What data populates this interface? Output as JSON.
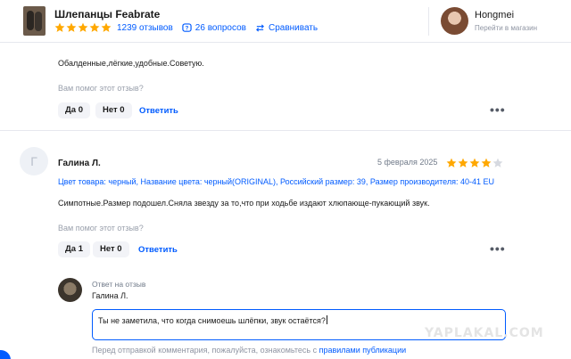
{
  "header": {
    "product_title": "Шлепанцы Feabrate",
    "rating_stars": 5,
    "reviews_count": "1239 отзывов",
    "questions_count": "26 вопросов",
    "compare_label": "Сравнивать",
    "seller": {
      "name": "Hongmei",
      "subtitle": "Перейти в магазин"
    }
  },
  "review_prev": {
    "text": "Обалденные,лёгкие,удобные.Советую.",
    "helpful_question": "Вам помог этот отзыв?",
    "yes_label": "Да 0",
    "no_label": "Нет 0",
    "reply_label": "Ответить",
    "more_label": "•••"
  },
  "review": {
    "avatar_letter": "Г",
    "author": "Галина Л.",
    "date": "5 февраля 2025",
    "rating": 4,
    "rating_max": 5,
    "properties": "Цвет товара: черный, Название цвета: черный(ORIGINAL), Российский размер: 39, Размер производителя: 40-41 EU",
    "text": "Симпотные.Размер подошел.Сняла звезду за то,что при ходьбе издают хлюпающе-пукающий звук.",
    "helpful_question": "Вам помог этот отзыв?",
    "yes_label": "Да 1",
    "no_label": "Нет 0",
    "reply_label": "Ответить",
    "more_label": "•••"
  },
  "reply_form": {
    "title": "Ответ на отзыв",
    "reply_to": "Галина Л.",
    "input_value": "Ты не заметила, что когда снимоешь шлёпки, звук остаётся?",
    "rules_prefix": "Перед отправкой комментария, пожалуйста, ознакомьтесь с",
    "rules_link": "правилами публикации"
  },
  "watermark": "YAPLAKAL.COM",
  "colors": {
    "accent": "#005bff",
    "star": "#ffa800",
    "star_empty": "#d6d9e0"
  }
}
